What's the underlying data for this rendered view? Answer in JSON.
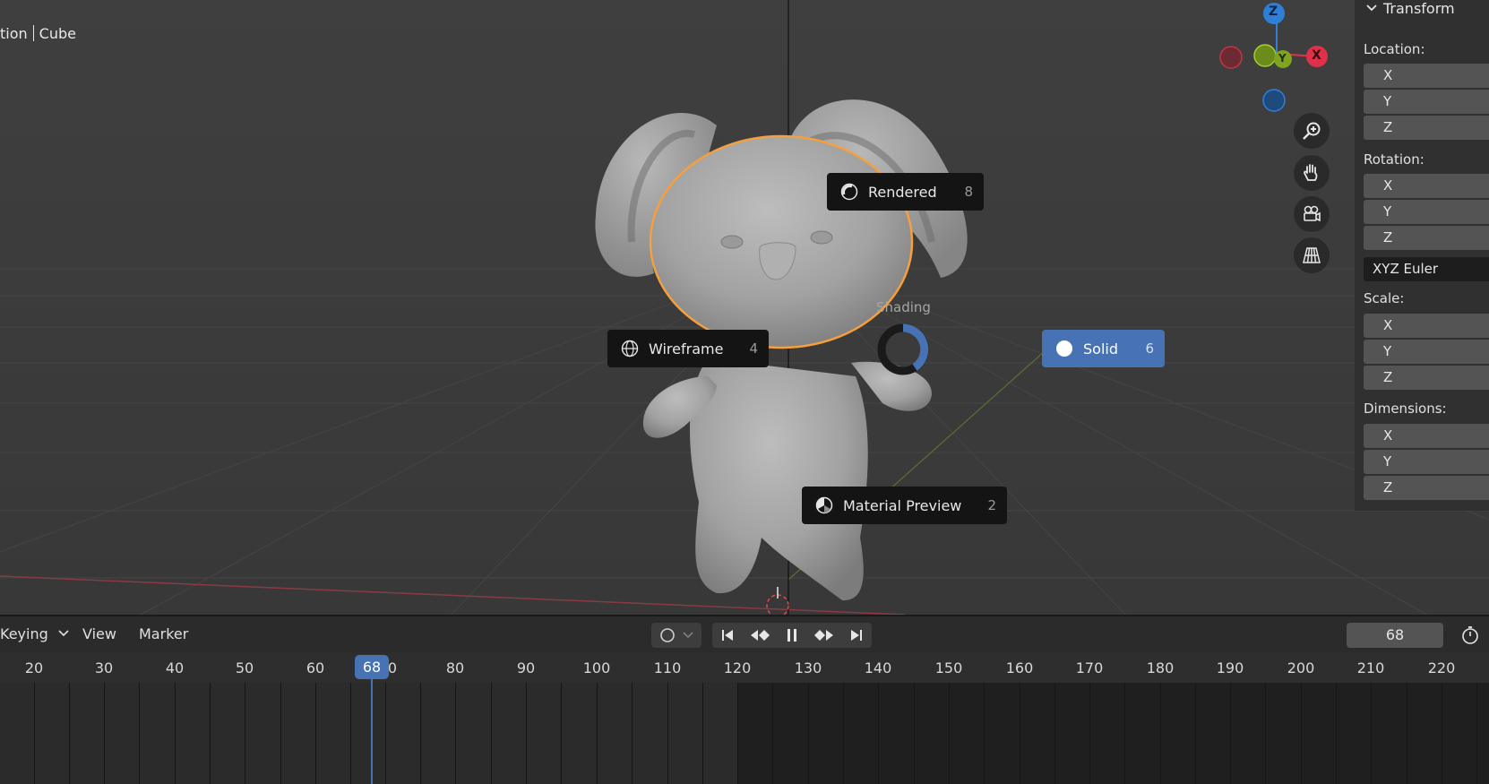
{
  "viewport": {
    "object_label_left": "tion",
    "object_label_right": "Cube"
  },
  "gizmo": {
    "z": "Z",
    "y": "Y",
    "x": "X"
  },
  "pie_menu": {
    "title": "Shading",
    "items": [
      {
        "label": "Rendered",
        "key": "8",
        "icon": "rendered-icon"
      },
      {
        "label": "Wireframe",
        "key": "4",
        "icon": "wireframe-icon"
      },
      {
        "label": "Solid",
        "key": "6",
        "icon": "solid-icon",
        "active": true
      },
      {
        "label": "Material Preview",
        "key": "2",
        "icon": "material-preview-icon"
      }
    ]
  },
  "nav_tools": [
    "zoom-icon",
    "pan-hand-icon",
    "camera-icon",
    "perspective-grid-icon"
  ],
  "npanel": {
    "header": "Transform",
    "location_label": "Location:",
    "rotation_label": "Rotation:",
    "rotation_mode": "XYZ Euler",
    "scale_label": "Scale:",
    "dimensions_label": "Dimensions:",
    "axis_x": "X",
    "axis_y": "Y",
    "axis_z": "Z"
  },
  "timeline": {
    "menu_keying": "Keying",
    "menu_view": "View",
    "menu_marker": "Marker",
    "current_frame": "68",
    "ruler_ticks": [
      "20",
      "30",
      "40",
      "50",
      "60",
      "0",
      "80",
      "90",
      "100",
      "110",
      "120",
      "130",
      "140",
      "150",
      "160",
      "170",
      "180",
      "190",
      "200",
      "210",
      "220"
    ],
    "playhead_label": "68"
  },
  "colors": {
    "accent": "#4772b3",
    "selection_outline": "#f5a03c",
    "axis_x": "#e0314b",
    "axis_y": "#7fa41e",
    "axis_z": "#2f7fd6"
  }
}
